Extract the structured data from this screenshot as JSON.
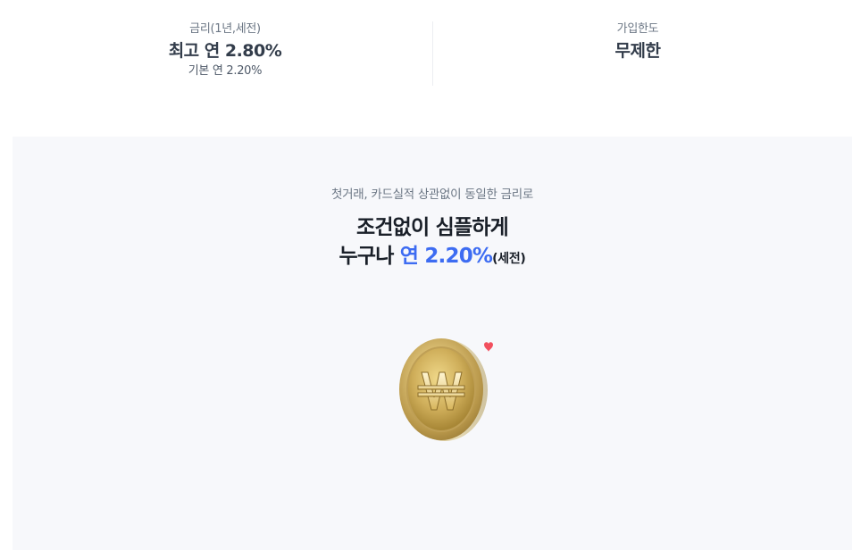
{
  "summary": {
    "rate": {
      "label": "금리(1년,세전)",
      "max_rate": "최고 연 2.80%",
      "base_rate": "기본 연 2.20%"
    },
    "limit": {
      "label": "가입한도",
      "value": "무제한"
    }
  },
  "promo": {
    "subtitle": "첫거래, 카드실적 상관없이 동일한 금리로",
    "title_line1": "조건없이 심플하게",
    "title_line2_prefix": "누구나 ",
    "title_line2_accent": "연 2.20%",
    "title_line2_suffix": "(세전)",
    "accent_color": "#3d6cf2",
    "illustration": "gold-won-coin-with-heart"
  }
}
